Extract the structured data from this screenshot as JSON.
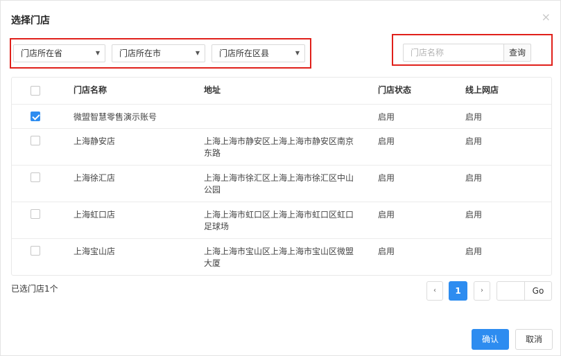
{
  "dialog": {
    "title": "选择门店",
    "close_glyph": "×"
  },
  "filters": {
    "province": "门店所在省",
    "city": "门店所在市",
    "district": "门店所在区县",
    "arrow_glyph": "▼"
  },
  "search": {
    "placeholder": "门店名称",
    "value": "",
    "button_label": "查询"
  },
  "table": {
    "headers": {
      "name": "门店名称",
      "address": "地址",
      "status": "门店状态",
      "online": "线上网店"
    },
    "rows": [
      {
        "checked": true,
        "name": "微盟智慧零售演示账号",
        "address": "",
        "status": "启用",
        "online": "启用"
      },
      {
        "checked": false,
        "name": "上海静安店",
        "address": "上海上海市静安区上海上海市静安区南京东路",
        "status": "启用",
        "online": "启用"
      },
      {
        "checked": false,
        "name": "上海徐汇店",
        "address": "上海上海市徐汇区上海上海市徐汇区中山公园",
        "status": "启用",
        "online": "启用"
      },
      {
        "checked": false,
        "name": "上海虹口店",
        "address": "上海上海市虹口区上海上海市虹口区虹口足球场",
        "status": "启用",
        "online": "启用"
      },
      {
        "checked": false,
        "name": "上海宝山店",
        "address": "上海上海市宝山区上海上海市宝山区微盟大厦",
        "status": "启用",
        "online": "启用"
      }
    ]
  },
  "footer": {
    "selected_text": "已选门店1个",
    "prev_glyph": "‹",
    "next_glyph": "›",
    "current_page": "1",
    "goto_label": "Go",
    "confirm_label": "确认",
    "cancel_label": "取消"
  },
  "colors": {
    "accent": "#2d8cf0",
    "highlight_border": "#e0201a"
  }
}
